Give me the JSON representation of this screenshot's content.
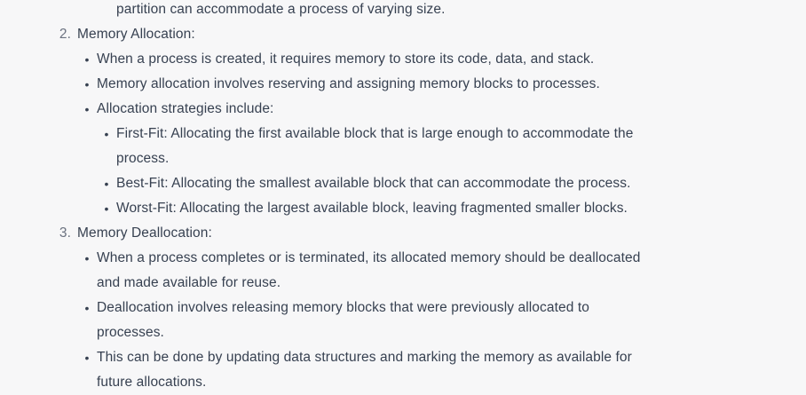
{
  "continuation": "partition can accommodate a process of varying size.",
  "sections": [
    {
      "number": "2.",
      "title": "Memory Allocation:",
      "bullets": [
        "When a process is created, it requires memory to store its code, data, and stack.",
        "Memory allocation involves reserving and assigning memory blocks to processes.",
        "Allocation strategies include:"
      ],
      "sub_bullets": [
        {
          "line1": "First-Fit: Allocating the first available block that is large enough to accommodate the",
          "line2": "process."
        },
        {
          "line1": "Best-Fit: Allocating the smallest available block that can accommodate the process."
        },
        {
          "line1": "Worst-Fit: Allocating the largest available block, leaving fragmented smaller blocks."
        }
      ]
    },
    {
      "number": "3.",
      "title": "Memory Deallocation:",
      "bullets": [
        {
          "line1": "When a process completes or is terminated, its allocated memory should be deallocated",
          "line2": "and made available for reuse."
        },
        {
          "line1": "Deallocation involves releasing memory blocks that were previously allocated to",
          "line2": "processes."
        },
        {
          "line1": "This can be done by updating data structures and marking the memory as available for",
          "line2": "future allocations."
        }
      ]
    }
  ]
}
